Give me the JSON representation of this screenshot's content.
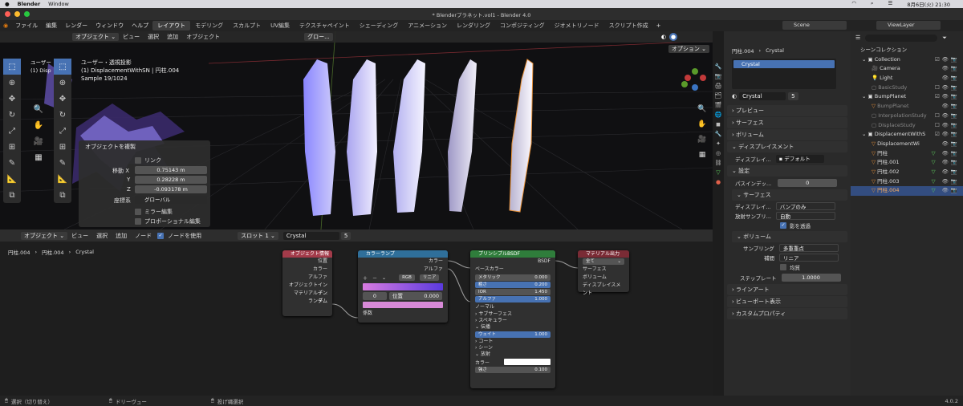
{
  "macos": {
    "app": "Blender",
    "window_menu": "Window",
    "datetime": "8月6日(火) 21:30"
  },
  "window_title": "* Blenderプラネット.vol1 - Blender 4.0",
  "top_menu": [
    "ファイル",
    "編集",
    "レンダー",
    "ウィンドウ",
    "ヘルプ"
  ],
  "workspace_tabs": [
    "レイアウト",
    "モデリング",
    "スカルプト",
    "UV編集",
    "テクスチャペイント",
    "シェーディング",
    "アニメーション",
    "レンダリング",
    "コンポジティング",
    "ジオメトリノード",
    "スクリプト作成"
  ],
  "scene": {
    "label": "Scene",
    "viewlayer": "ViewLayer"
  },
  "viewport": {
    "header": {
      "mode": "オブジェクト",
      "menus": [
        "ビュー",
        "選択",
        "追加",
        "オブジェクト"
      ],
      "orientation": "グロー..."
    },
    "options_label": "オプション",
    "overlay": {
      "line1": "ユーザー・透視投影",
      "line2": "(1) DisplacementWithSN | 円柱.004",
      "line3": "Sample 19/1024"
    },
    "bg_overlay": {
      "line1": "ユーザー",
      "line2": "(1) Disp"
    },
    "redo_panel": {
      "title": "オブジェクトを複製",
      "link_label": "リンク",
      "move_label": "移動 X",
      "y_label": "Y",
      "z_label": "Z",
      "x": "0.75143 m",
      "y": "0.28228 m",
      "z": "-0.093178 m",
      "orientation_label": "座標系",
      "orientation": "グローバル",
      "mirror_label": "ミラー編集",
      "proportional_label": "プロポーショナル編集"
    }
  },
  "node_editor": {
    "header": {
      "mode": "オブジェクト",
      "menus": [
        "ビュー",
        "選択",
        "追加",
        "ノード"
      ],
      "use_nodes": "ノードを使用",
      "slot": "スロット 1",
      "material": "Crystal",
      "users": "5"
    },
    "breadcrumb": [
      "円柱.004",
      "円柱.004",
      "Crystal"
    ],
    "object_info": {
      "title": "オブジェクト情報",
      "outputs": [
        "位置",
        "カラー",
        "アルファ",
        "オブジェクトインデ...",
        "マテリアルインデ...",
        "ランダム"
      ]
    },
    "color_ramp": {
      "title": "カラーランプ",
      "outputs": [
        "カラー",
        "アルファ"
      ],
      "mode": "RGB",
      "interp": "リニア",
      "index": "0",
      "pos_label": "位置",
      "pos": "0.000",
      "input": "係数"
    },
    "principled": {
      "title": "プリンシプルBSDF",
      "output": "BSDF",
      "base_color": "ベースカラー",
      "metallic": "メタリック",
      "metallic_v": "0.000",
      "rough": "粗さ",
      "rough_v": "0.200",
      "ior": "IOR",
      "ior_v": "1.450",
      "alpha": "アルファ",
      "alpha_v": "1.000",
      "normal": "ノーマル",
      "subsurface": "サブサーフェス",
      "specular": "スペキュラー",
      "transmission": "伝播",
      "weight": "ウェイト",
      "weight_v": "1.000",
      "coat": "コート",
      "sheen": "シーン",
      "emission": "放射",
      "color": "カラー",
      "strength": "強さ",
      "strength_v": "0.100"
    },
    "material_output": {
      "title": "マテリアル出力",
      "target": "全て",
      "inputs": [
        "サーフェス",
        "ボリューム",
        "ディスプレイスメント"
      ]
    }
  },
  "properties": {
    "breadcrumb": [
      "円柱.004",
      "Crystal"
    ],
    "slot_name": "Crystal",
    "material_name": "Crystal",
    "users": "5",
    "sections": {
      "preview": "プレビュー",
      "surface": "サーフェス",
      "volume": "ボリューム",
      "displacement": "ディスプレイスメント",
      "settings": "設定",
      "lineart": "ラインアート",
      "viewport": "ビューポート表示",
      "custom": "カスタムプロパティ"
    },
    "displacement_label": "ディスプレイ...",
    "displacement_value": "デフォルト",
    "pass_index_label": "パスインデッ...",
    "pass_index": "0",
    "sub_surface": "サーフェス",
    "disp_method_label": "ディスプレイ...",
    "disp_method": "バンプのみ",
    "emission_sampling_label": "放射サンプリ...",
    "emission_sampling": "自動",
    "transparent_shadow": "影を透過",
    "sub_volume": "ボリューム",
    "sampling_label": "サンプリング",
    "sampling": "多重重点",
    "interp_label": "補間",
    "interp": "リニア",
    "homogeneous": "均質",
    "step_rate_label": "ステップレート",
    "step_rate": "1.0000"
  },
  "outliner": {
    "title": "シーンコレクション",
    "items": [
      "Collection",
      "Camera",
      "Light",
      "BasicStudy",
      "BumpPlanet",
      "BumpPlanet",
      "InterpolationStudy",
      "DisplaceStudy",
      "DisplacementWithS",
      "DisplacementWi",
      "円柱",
      "円柱.001",
      "円柱.002",
      "円柱.003",
      "円柱.004"
    ]
  },
  "statusbar": {
    "select": "選択（切り替え）",
    "pan": "ドリーヴュー",
    "lasso": "投げ縄選択",
    "version": "4.0.2"
  },
  "colors": {
    "accent": "#4772b3",
    "object_info_header": "#a33b4a",
    "color_ramp_header": "#2f6f9a",
    "bsdf_header": "#2f7d3b",
    "output_header": "#7a2b35"
  }
}
